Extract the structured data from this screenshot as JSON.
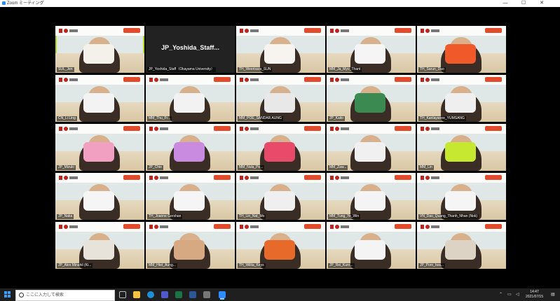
{
  "window": {
    "title": "Zoom ミーティング",
    "minimize_glyph": "—",
    "maximize_glyph": "☐",
    "close_glyph": "✕",
    "app_icon": "zoom-icon"
  },
  "participants": [
    {
      "name": "SUL_Jen",
      "craft_color": "#f4f0ea"
    },
    {
      "name": "JP_Yoshida_Staff（Okayama University）",
      "video_label": "JP_Yoshida_Staff...",
      "video_off": true
    },
    {
      "name": "TH_Weerisara_SUN",
      "craft_color": "#f7f4ef"
    },
    {
      "name": "MM_Ja_Myo_Thant",
      "craft_color": "#f5f5f5"
    },
    {
      "name": "TH_Sarun_Dao",
      "craft_color": "#f05a2a"
    },
    {
      "name": "CN_Li Ling",
      "craft_color": "#f3f3f3"
    },
    {
      "name": "MM_Thu_Fr...",
      "craft_color": "#f2f2f2"
    },
    {
      "name": "MM_POE_SANDAR AUNG",
      "craft_color": "#e8e8e8"
    },
    {
      "name": "JP_Kaito",
      "craft_color": "#3b8a52"
    },
    {
      "name": "TH_Kanlayanee_YUMSANG",
      "craft_color": "#efefef"
    },
    {
      "name": "JP_Mizuki",
      "craft_color": "#f2a0c2"
    },
    {
      "name": "JP_Chie",
      "craft_color": "#c98be0"
    },
    {
      "name": "MM_Nula_Pe...",
      "craft_color": "#e84a6a"
    },
    {
      "name": "MM_Zaw...",
      "craft_color": "#f0f0f0"
    },
    {
      "name": "MM_Lin",
      "craft_color": "#c6e830"
    },
    {
      "name": "JP_Naka",
      "craft_color": "#f5f5f5"
    },
    {
      "name": "TH_Joanne Gershan",
      "craft_color": "#f5f5f5"
    },
    {
      "name": "TH_Lin_Nat_Mo",
      "craft_color": "#efefef"
    },
    {
      "name": "MM_Tung_Ye_Win",
      "craft_color": "#f4f4f4"
    },
    {
      "name": "VN_Dao_Quang_Thanh_Nhan (Nok)",
      "craft_color": "#f5f5f5"
    },
    {
      "name": "JP_Alex Minahil (Ki...",
      "craft_color": "#e8e3da"
    },
    {
      "name": "MM_Htet_Aung...",
      "craft_color": "#d7a982"
    },
    {
      "name": "TH_Wilita_Keys",
      "craft_color": "#e86a2a"
    },
    {
      "name": "JP_Rei_Kuro...",
      "craft_color": "#f4f4f4"
    },
    {
      "name": "JP_Porn_Iwa...",
      "craft_color": "#dcd3c4"
    }
  ],
  "taskbar": {
    "search_placeholder": "ここに入力して検索",
    "clock_time": "14:47",
    "clock_date": "2021/07/15",
    "icons": [
      "task-view-icon",
      "file-explorer-icon",
      "edge-icon",
      "teams-icon",
      "excel-icon",
      "word-icon",
      "photos-icon",
      "zoom-icon"
    ]
  },
  "colors": {
    "active_speaker": "#b8d82a",
    "banner_red": "#c0231c",
    "zoom_blue": "#2d8cff"
  }
}
